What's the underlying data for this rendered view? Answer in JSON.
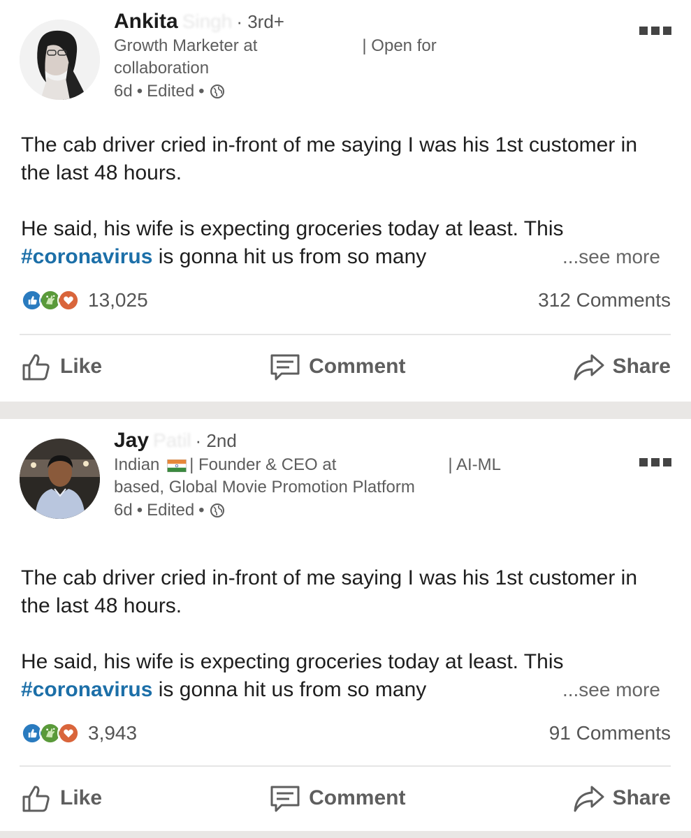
{
  "posts": [
    {
      "author_first": "Ankita",
      "author_blurred": "Singh",
      "degree": "· 3rd+",
      "headline_1": "Growth Marketer at",
      "headline_2": "| Open for",
      "headline_3": "collaboration",
      "time": "6d",
      "edited": "Edited",
      "text_1": "The cab driver cried in-front of me saying I was his 1st customer in the last 48 hours.",
      "text_2a": "He said, his wife is expecting groceries today at least. This",
      "hashtag": "#coronavirus",
      "text_2b": " is gonna hit us from so many",
      "see_more": "...see more",
      "reactions_count": "13,025",
      "comments": "312 Comments",
      "actions": {
        "like": "Like",
        "comment": "Comment",
        "share": "Share"
      }
    },
    {
      "author_first": "Jay",
      "author_blurred": "Patil",
      "degree": "· 2nd",
      "headline_1": "Indian",
      "headline_2": "| Founder & CEO at",
      "headline_3": "| AI-ML",
      "headline_4": "based, Global Movie Promotion Platform",
      "time": "6d",
      "edited": "Edited",
      "text_1": "The cab driver cried in-front of me saying I was his 1st customer in the last 48 hours.",
      "text_2a": "He said, his wife is expecting groceries today at least. This",
      "hashtag": "#coronavirus",
      "text_2b": " is gonna hit us from so many",
      "see_more": "...see more",
      "reactions_count": "3,943",
      "comments": "91 Comments",
      "actions": {
        "like": "Like",
        "comment": "Comment",
        "share": "Share"
      }
    }
  ],
  "icons": {
    "more": "more-options-icon",
    "globe": "globe-icon",
    "like_reaction": "thumbs-up-reaction-icon",
    "celebrate_reaction": "celebrate-reaction-icon",
    "love_reaction": "heart-reaction-icon",
    "like": "thumbs-up-icon",
    "comment": "comment-icon",
    "share": "share-arrow-icon",
    "flag": "india-flag-icon"
  },
  "colors": {
    "hashtag": "#1c6fa8",
    "like_reaction": "#2a7bbf",
    "celebrate_reaction": "#5a9a3a",
    "love_reaction": "#d9653b",
    "separator": "#e9e7e5"
  }
}
